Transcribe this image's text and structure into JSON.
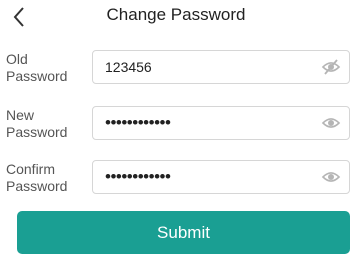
{
  "header": {
    "back_icon": "chevron-left-icon",
    "title": "Change Password"
  },
  "form": {
    "fields": [
      {
        "label_line1": "Old",
        "label_line2": "Password",
        "value": "123456",
        "visibility_icon": "eye-off-icon"
      },
      {
        "label_line1": "New",
        "label_line2": "Password",
        "value": "••••••••••••",
        "visibility_icon": "eye-icon"
      },
      {
        "label_line1": "Confirm",
        "label_line2": "Password",
        "value": "••••••••••••",
        "visibility_icon": "eye-icon"
      }
    ]
  },
  "submit": {
    "label": "Submit",
    "color": "#1a9f93"
  }
}
